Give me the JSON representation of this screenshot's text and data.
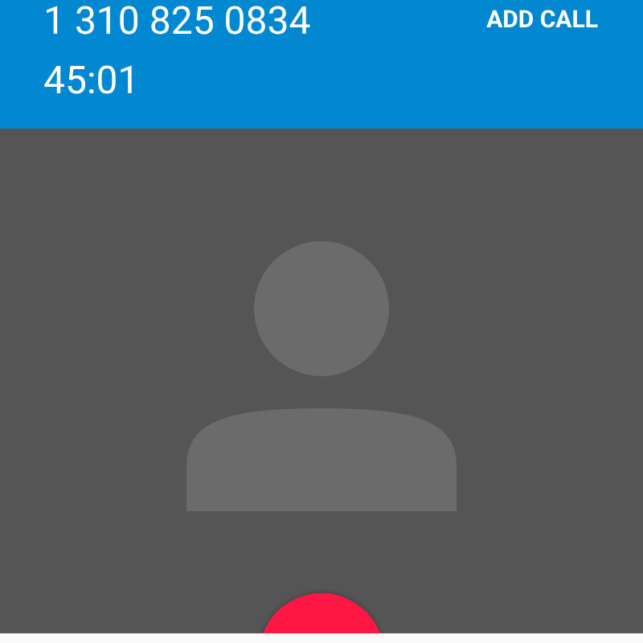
{
  "call": {
    "number": "1 310 825 0834",
    "duration": "45:01",
    "action": "ADD CALL"
  }
}
